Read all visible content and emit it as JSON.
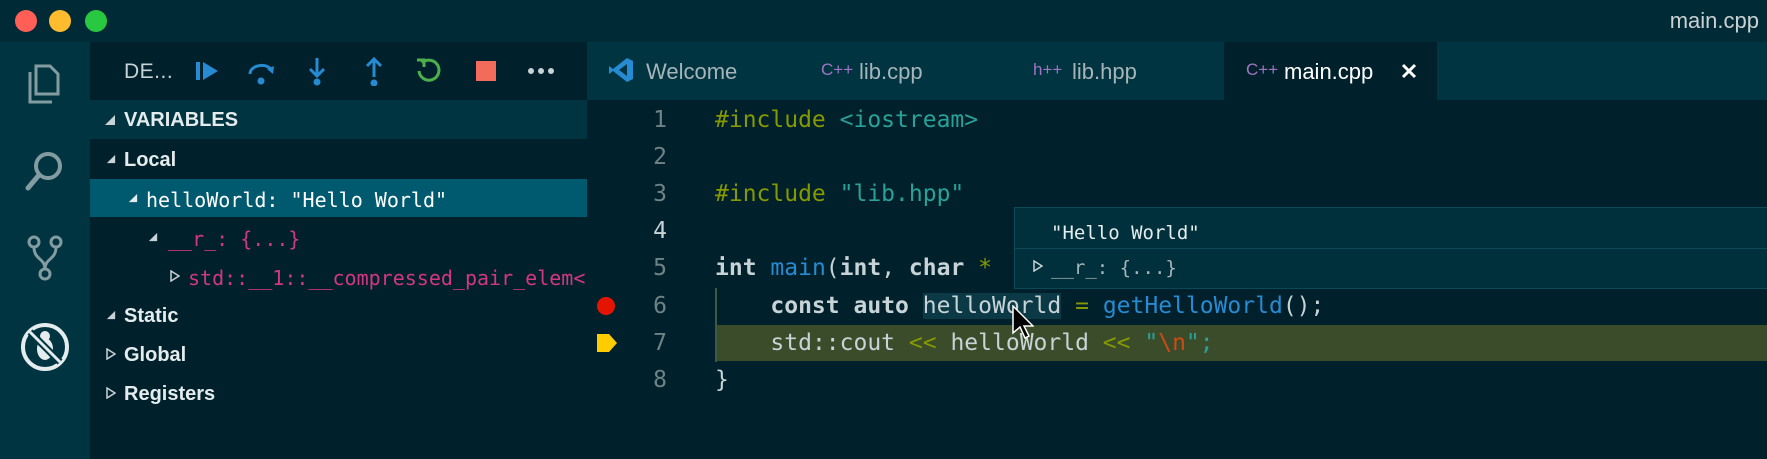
{
  "window": {
    "title": "main.cpp"
  },
  "activity_bar": {
    "icons": [
      "explorer-icon",
      "search-icon",
      "source-control-icon",
      "no-bug-debug-icon"
    ]
  },
  "debug_toolbar": {
    "config_label": "DE...",
    "buttons": [
      "continue",
      "step-over",
      "step-into",
      "step-out",
      "restart",
      "stop",
      "more"
    ]
  },
  "variables": {
    "header": "VARIABLES",
    "local_label": "Local",
    "hello_row": "helloWorld: \"Hello World\"",
    "r_row": "__r_: {...}",
    "pair_row": "std::__1::__compressed_pair_elem<...",
    "static_label": "Static",
    "global_label": "Global",
    "registers_label": "Registers"
  },
  "tabs": [
    {
      "label": "Welcome",
      "icon": "vscode-icon",
      "active": false
    },
    {
      "label": "lib.cpp",
      "icon": "cpp-icon",
      "active": false
    },
    {
      "label": "lib.hpp",
      "icon": "hpp-icon",
      "active": false
    },
    {
      "label": "main.cpp",
      "icon": "cpp-icon",
      "active": true
    }
  ],
  "code": {
    "line_numbers": [
      "1",
      "2",
      "3",
      "4",
      "5",
      "6",
      "7",
      "8"
    ],
    "l1_directive": "#include",
    "l1_header": "<iostream>",
    "l3_directive": "#include",
    "l3_header": "\"lib.hpp\"",
    "l5_int": "int",
    "l5_main": "main",
    "l5_open": "(",
    "l5_int2": "int",
    "l5_comma": ",",
    "l5_char": "char",
    "l5_star": "*",
    "l6_const": "const",
    "l6_auto": "auto",
    "l6_var": "helloWorld",
    "l6_eq": "=",
    "l6_fn": "getHelloWorld",
    "l6_end": "();",
    "l7_std": "std",
    "l7_colons": "::",
    "l7_cout": "cout",
    "l7_op1": "<<",
    "l7_var": "helloWorld",
    "l7_op2": "<<",
    "l7_q1": "\"",
    "l7_esc": "\\n",
    "l7_q2": "\";",
    "l8_close": "}"
  },
  "hover": {
    "value": "\"Hello World\"",
    "child": "__r_: {...}"
  },
  "colors": {
    "breakpoint": "#e51400",
    "current_line": "#3b4c2a",
    "current_arrow": "#ffcc00",
    "selection": "#005a6f"
  }
}
